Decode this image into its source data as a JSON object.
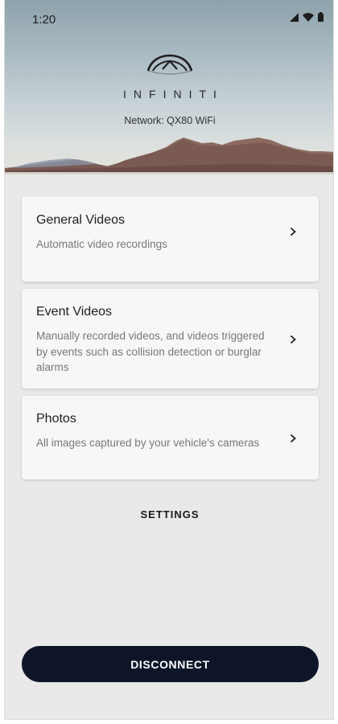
{
  "status_bar": {
    "time": "1:20"
  },
  "header": {
    "brand": "INFINITI",
    "network": "Network: QX80 WiFi"
  },
  "menu": [
    {
      "title": "General Videos",
      "description": "Automatic video recordings"
    },
    {
      "title": "Event Videos",
      "description": "Manually recorded videos, and videos triggered by events such as collision detection or burglar alarms"
    },
    {
      "title": "Photos",
      "description": "All images captured by your vehicle's cameras"
    }
  ],
  "settings_label": "SETTINGS",
  "disconnect_label": "DISCONNECT",
  "colors": {
    "disconnect_button": "#0e1528",
    "background": "#e9e9e9",
    "card": "#f7f7f7"
  },
  "icons": [
    "signal-icon",
    "wifi-icon",
    "battery-icon",
    "infiniti-logo",
    "chevron-right-icon"
  ]
}
